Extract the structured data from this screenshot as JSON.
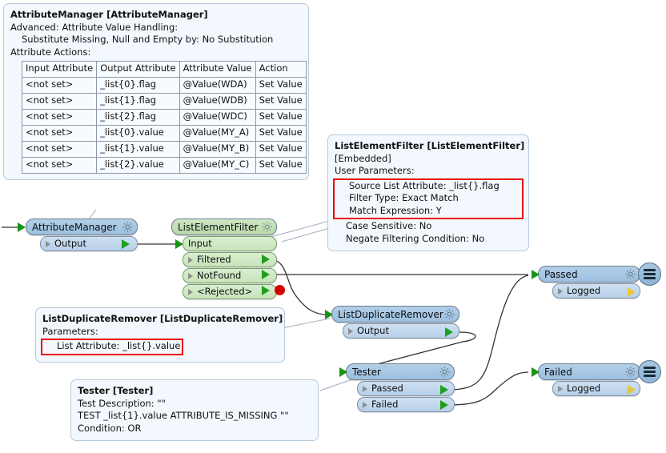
{
  "annotations": {
    "attribute_manager": {
      "title": "AttributeManager [AttributeManager]",
      "line1": "Advanced: Attribute Value Handling:",
      "line2": "Substitute Missing, Null and Empty by: No Substitution",
      "line3": "Attribute Actions:",
      "table": {
        "headers": [
          "Input Attribute",
          "Output Attribute",
          "Attribute Value",
          "Action"
        ],
        "rows": [
          [
            "<not set>",
            "_list{0}.flag",
            "@Value(WDA)",
            "Set Value"
          ],
          [
            "<not set>",
            "_list{1}.flag",
            "@Value(WDB)",
            "Set Value"
          ],
          [
            "<not set>",
            "_list{2}.flag",
            "@Value(WDC)",
            "Set Value"
          ],
          [
            "<not set>",
            "_list{0}.value",
            "@Value(MY_A)",
            "Set Value"
          ],
          [
            "<not set>",
            "_list{1}.value",
            "@Value(MY_B)",
            "Set Value"
          ],
          [
            "<not set>",
            "_list{2}.value",
            "@Value(MY_C)",
            "Set Value"
          ]
        ]
      }
    },
    "list_element_filter": {
      "title": "ListElementFilter [ListElementFilter]",
      "line1": "[Embedded]",
      "line2": "User Parameters:",
      "highlighted": [
        "Source List Attribute: _list{}.flag",
        "Filter Type: Exact Match",
        "Match Expression: Y"
      ],
      "after": [
        "Case Sensitive: No",
        "Negate Filtering Condition: No"
      ]
    },
    "list_duplicate_remover": {
      "title": "ListDuplicateRemover [ListDuplicateRemover]",
      "line1": "Parameters:",
      "highlighted": [
        "List Attribute: _list{}.value"
      ]
    },
    "tester": {
      "title": "Tester [Tester]",
      "line1": "Test Description: \"\"",
      "line2": "TEST _list{1}.value ATTRIBUTE_IS_MISSING \"\"",
      "line3": "Condition: OR"
    }
  },
  "nodes": {
    "attribute_manager": {
      "label": "AttributeManager",
      "ports": [
        "Output"
      ]
    },
    "list_element_filter": {
      "label": "ListElementFilter",
      "ports": [
        "Input",
        "Filtered",
        "NotFound",
        "<Rejected>"
      ]
    },
    "list_duplicate_remover": {
      "label": "ListDuplicateRemover",
      "ports": [
        "Output"
      ]
    },
    "tester": {
      "label": "Tester",
      "ports": [
        "Passed",
        "Failed"
      ]
    },
    "passed_writer": {
      "label": "Passed",
      "ports": [
        "Logged"
      ]
    },
    "failed_writer": {
      "label": "Failed",
      "ports": [
        "Logged"
      ]
    }
  },
  "colors": {
    "node_blue": "#9cc0e0",
    "node_green": "#b9d9ab",
    "port_blue": "#b7d0e8",
    "port_green": "#c7e4ba",
    "highlight_red": "#ee0000",
    "arrow_green": "#1f9e1f",
    "arrow_yellow": "#e8c53c",
    "reject_dot": "#d40000",
    "annotation_bg": "#f2f8fd",
    "annotation_border": "#b8c9d9",
    "canvas_bg": "#ffffff"
  }
}
